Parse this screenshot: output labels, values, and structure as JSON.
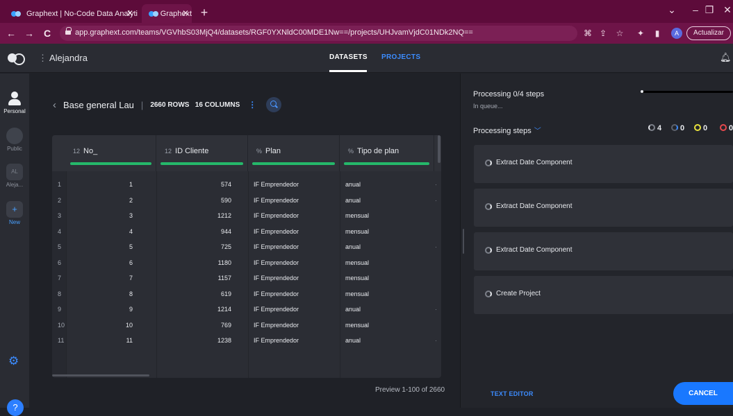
{
  "browser": {
    "tabs": [
      {
        "title": "Graphext | No-Code Data Analyti",
        "active": false
      },
      {
        "title": "Graphext",
        "active": true
      }
    ],
    "new_tab": "+",
    "url": "app.graphext.com/teams/VGVhbS03MjQ4/datasets/RGF0YXNldC00MDE1Nw==/projects/UHJvamVjdC01NDk2NQ==",
    "avatar_letter": "A",
    "update_label": "Actualizar"
  },
  "header": {
    "team": "Alejandra",
    "nav": {
      "datasets": "DATASETS",
      "projects": "PROJECTS"
    }
  },
  "rail": {
    "personal": "Personal",
    "public": "Public",
    "aleja_badge": "AL",
    "aleja": "Aleja...",
    "new": "New",
    "help": "?"
  },
  "dataset": {
    "name": "Base general Lau",
    "meta": "2660 ROWS   16 COLUMNS",
    "columns": [
      {
        "icon": "12",
        "name": "No_"
      },
      {
        "icon": "12",
        "name": "ID Cliente"
      },
      {
        "icon": "%",
        "name": "Plan"
      },
      {
        "icon": "%",
        "name": "Tipo de plan"
      }
    ],
    "rows": [
      {
        "idx": "1",
        "no": "1",
        "id": "574",
        "plan": "IF Emprendedor",
        "tipo": "anual"
      },
      {
        "idx": "2",
        "no": "2",
        "id": "590",
        "plan": "IF Emprendedor",
        "tipo": "anual"
      },
      {
        "idx": "3",
        "no": "3",
        "id": "1212",
        "plan": "IF Emprendedor",
        "tipo": "mensual"
      },
      {
        "idx": "4",
        "no": "4",
        "id": "944",
        "plan": "IF Emprendedor",
        "tipo": "mensual"
      },
      {
        "idx": "5",
        "no": "5",
        "id": "725",
        "plan": "IF Emprendedor",
        "tipo": "anual"
      },
      {
        "idx": "6",
        "no": "6",
        "id": "1180",
        "plan": "IF Emprendedor",
        "tipo": "mensual"
      },
      {
        "idx": "7",
        "no": "7",
        "id": "1157",
        "plan": "IF Emprendedor",
        "tipo": "mensual"
      },
      {
        "idx": "8",
        "no": "8",
        "id": "619",
        "plan": "IF Emprendedor",
        "tipo": "mensual"
      },
      {
        "idx": "9",
        "no": "9",
        "id": "1214",
        "plan": "IF Emprendedor",
        "tipo": "anual"
      },
      {
        "idx": "10",
        "no": "10",
        "id": "769",
        "plan": "IF Emprendedor",
        "tipo": "mensual"
      },
      {
        "idx": "11",
        "no": "11",
        "id": "1238",
        "plan": "IF Emprendedor",
        "tipo": "anual"
      }
    ],
    "preview": "Preview 1-100 of 2660"
  },
  "processing": {
    "title": "Processing 0/4 steps",
    "status": "In queue...",
    "progress_fraction": 0,
    "steps_title": "Processing steps",
    "counts": {
      "running": "4",
      "pending": "0",
      "warning": "0",
      "error": "0"
    },
    "colors": {
      "running": "#e8eaee",
      "pending": "#3c8cff",
      "warning": "#e8e23c",
      "error": "#e5484d"
    },
    "steps": [
      "Extract Date Component",
      "Extract Date Component",
      "Extract Date Component",
      "Create Project"
    ],
    "text_editor": "TEXT EDITOR",
    "cancel": "CANCEL"
  }
}
